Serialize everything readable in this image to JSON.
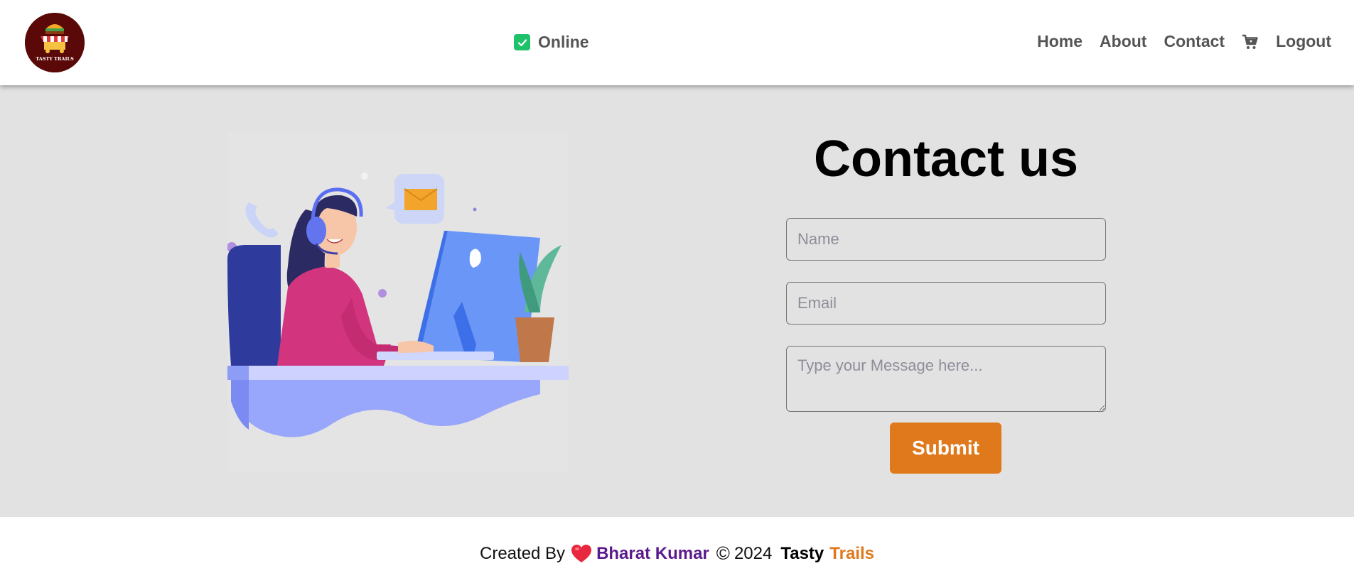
{
  "header": {
    "logo_text": "TASTY TRAILS",
    "status": {
      "label": "Online",
      "color": "#1fc16b"
    },
    "nav": [
      {
        "label": "Home"
      },
      {
        "label": "About"
      },
      {
        "label": "Contact"
      },
      {
        "icon": "cart-icon"
      },
      {
        "label": "Logout"
      }
    ]
  },
  "contact": {
    "title": "Contact us",
    "name_placeholder": "Name",
    "email_placeholder": "Email",
    "message_placeholder": "Type your Message here...",
    "submit_label": "Submit",
    "accent": "#df791c"
  },
  "footer": {
    "created_by": "Created By",
    "author": "Bharat Kumar",
    "copyright_symbol": "©",
    "year": "2024",
    "brand_first": "Tasty",
    "brand_second": "Trails",
    "author_color": "#5b1b8c"
  }
}
